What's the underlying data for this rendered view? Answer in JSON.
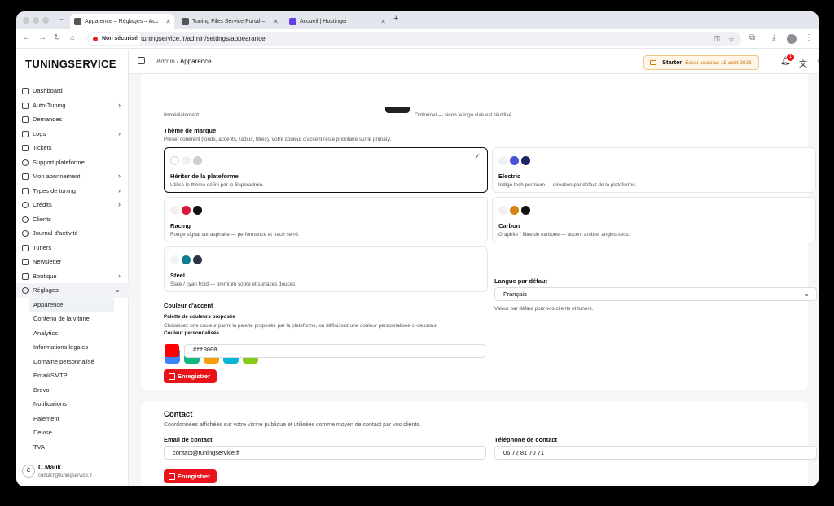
{
  "browser": {
    "tabs": [
      {
        "title": "Apparence – Réglages – Acc"
      },
      {
        "title": "Tuning Files Service Portal –"
      },
      {
        "title": "Accueil | Hostinger"
      }
    ],
    "security_label": "Non sécurisé",
    "url": "tuningservice.fr/admin/settings/appearance"
  },
  "sidebar": {
    "logo": "TUNINGSERVICE",
    "items": [
      {
        "label": "Dashboard"
      },
      {
        "label": "Auto-Tuning"
      },
      {
        "label": "Demandes"
      },
      {
        "label": "Logs"
      },
      {
        "label": "Tickets"
      },
      {
        "label": "Support plateforme"
      },
      {
        "label": "Mon abonnement"
      },
      {
        "label": "Types de tuning"
      },
      {
        "label": "Crédits"
      },
      {
        "label": "Clients"
      },
      {
        "label": "Journal d'activité"
      },
      {
        "label": "Tuners"
      },
      {
        "label": "Newsletter"
      },
      {
        "label": "Boutique"
      },
      {
        "label": "Réglages"
      }
    ],
    "subitems": [
      {
        "label": "Apparence"
      },
      {
        "label": "Contenu de la vitrine"
      },
      {
        "label": "Analytics"
      },
      {
        "label": "Informations légales"
      },
      {
        "label": "Domaine personnalisé"
      },
      {
        "label": "Email/SMTP"
      },
      {
        "label": "Brevo"
      },
      {
        "label": "Notifications"
      },
      {
        "label": "Paiement"
      },
      {
        "label": "Devise"
      },
      {
        "label": "TVA"
      }
    ],
    "user": {
      "initial": "C",
      "name": "C.Malik",
      "email": "contact@tuningservice.fr"
    }
  },
  "topbar": {
    "crumb_root": "Admin",
    "crumb_current": "Apparence",
    "plan": "Starter",
    "trial": "Essai jusqu'au 15 août 2026",
    "notif_count": "1"
  },
  "appearance": {
    "logo_hint_left": "immédiatement.",
    "logo_hint_right": "Optionnel — sinon le logo clair est réutilisé.",
    "theme_title": "Thème de marque",
    "theme_hint": "Preset cohérent (fonds, accents, radius, titres). Votre couleur d'accent reste prioritaire sur le primary.",
    "themes": [
      {
        "name": "Hériter de la plateforme",
        "desc": "Utilise le thème défini par le Superadmin.",
        "colors": [
          "#ffffff",
          "#eeeeee",
          "#cfcfcf"
        ],
        "selected": true
      },
      {
        "name": "Electric",
        "desc": "Indigo tech premium — direction par défaut de la plateforme.",
        "colors": [
          "#eef0f7",
          "#4a52d9",
          "#1f2466"
        ],
        "selected": false
      },
      {
        "name": "Racing",
        "desc": "Rouge signal sur asphalte — performance et tracé serré.",
        "colors": [
          "#f6eeee",
          "#d8183c",
          "#111111"
        ],
        "selected": false
      },
      {
        "name": "Carbon",
        "desc": "Graphite / fibre de carbone — accent ambre, angles secs.",
        "colors": [
          "#f1f1f1",
          "#d38412",
          "#111111"
        ],
        "selected": false
      },
      {
        "name": "Steel",
        "desc": "Slate / cyan froid — premium sobre et surfaces douces.",
        "colors": [
          "#eef3f6",
          "#137b93",
          "#2b3447"
        ],
        "selected": false
      }
    ],
    "accent_title": "Couleur d'accent",
    "palette_title": "Palette de couleurs proposée",
    "palette_hint": "Choisissez une couleur parmi la palette proposée par la plateforme, ou définissez une couleur personnalisée ci-dessous.",
    "palette": [
      "#3b82f6",
      "#10b981",
      "#f59e0b",
      "#06b6d4",
      "#84cc16"
    ],
    "custom_title": "Couleur personnalisée",
    "custom_value": "#ff0000",
    "custom_color": "#ff0000",
    "lang_title": "Langue par défaut",
    "lang_value": "Français",
    "lang_hint": "Valeur par défaut pour vos clients et tuners.",
    "save_label": "Enregistrer"
  },
  "contact": {
    "title": "Contact",
    "hint": "Coordonnées affichées sur votre vitrine publique et utilisées comme moyen de contact par vos clients.",
    "email_label": "Email de contact",
    "email_value": "contact@tuningservice.fr",
    "phone_label": "Téléphone de contact",
    "phone_value": "06 72 81 70 71",
    "save_label": "Enregistrer"
  }
}
